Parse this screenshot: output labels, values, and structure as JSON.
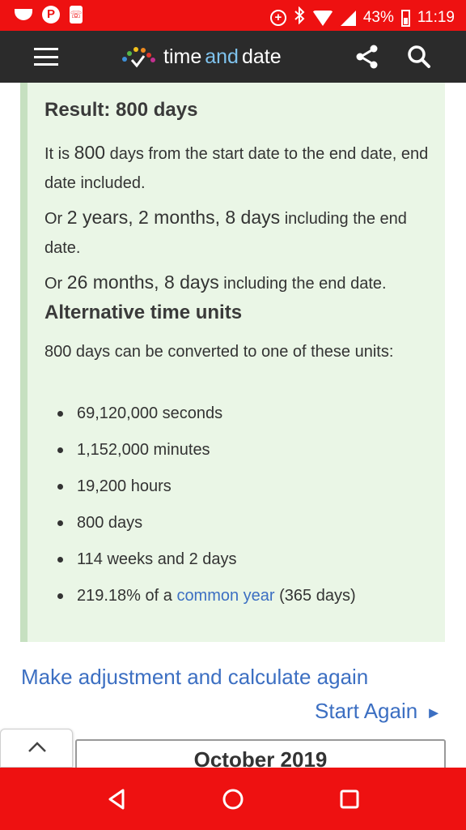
{
  "status_bar": {
    "battery": "43%",
    "time": "11:19",
    "left_icons": [
      "pill-icon",
      "p-icon",
      "phone-icon"
    ],
    "right_icons": [
      "data-saver-icon",
      "bluetooth-icon",
      "wifi-icon",
      "signal-icon",
      "battery-icon"
    ],
    "color": "#ee1111"
  },
  "header": {
    "logo_time": "time",
    "logo_and": "and",
    "logo_date": "date",
    "menu_icon": "hamburger-icon",
    "share_icon": "share-icon",
    "search_icon": "search-icon",
    "color": "#2b2b2b"
  },
  "result": {
    "title": "Result: 800 days",
    "para1": {
      "pre": "It is ",
      "value": "800",
      "post": " days from the start date to the end date, end date included."
    },
    "para2": {
      "pre": "Or ",
      "value": "2 years, 2 months, 8 days",
      "post": " including the end date."
    },
    "para3": {
      "pre": "Or ",
      "value": "26 months, 8 days",
      "post": " including the end date."
    },
    "panel_color": "#eaf6e6"
  },
  "alternative": {
    "title": "Alternative time units",
    "intro": "800 days can be converted to one of these units:",
    "units": [
      "69,120,000 seconds",
      "1,152,000 minutes",
      "19,200 hours",
      "800 days",
      "114 weeks and 2 days"
    ],
    "last_unit": {
      "pre": "219.18% of a ",
      "link": "common year",
      "post": " (365 days)"
    }
  },
  "actions": {
    "adjust": "Make adjustment and calculate again",
    "start_again": "Start Again",
    "start_arrow": "►",
    "link_color": "#3c6fc2"
  },
  "calendar": {
    "title": "October 2019"
  },
  "nav_bar": {
    "back_icon": "back-icon",
    "home_icon": "home-icon",
    "recents_icon": "recents-icon"
  }
}
